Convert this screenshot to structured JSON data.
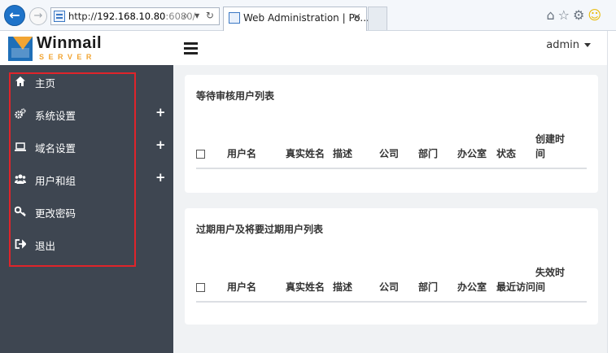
{
  "browser": {
    "url_prefix": "http://",
    "url_host": "192.168.10.80",
    "url_port": ":6080/",
    "address_tools": "⌕ ▾ ↻",
    "tab_title": "Web Administration | Po...",
    "tab_close": "×",
    "back_arrow": "←",
    "forward_arrow": "→",
    "right_icons": [
      "home-icon",
      "star-icon",
      "settings-gear-icon",
      "smiley-icon"
    ]
  },
  "header": {
    "logo_title": "Winmail",
    "logo_sub": "SERVER",
    "user": "admin"
  },
  "sidebar": {
    "items": [
      {
        "label": "主页",
        "icon": "home-icon",
        "expandable": false
      },
      {
        "label": "系统设置",
        "icon": "cogs-icon",
        "expandable": true
      },
      {
        "label": "域名设置",
        "icon": "laptop-icon",
        "expandable": true
      },
      {
        "label": "用户和组",
        "icon": "users-icon",
        "expandable": true
      },
      {
        "label": "更改密码",
        "icon": "key-icon",
        "expandable": false
      },
      {
        "label": "退出",
        "icon": "sign-out-icon",
        "expandable": false
      }
    ],
    "expand_symbol": "+",
    "highlight_color": "#e0242a"
  },
  "panels": {
    "pending": {
      "title": "等待审核用户列表",
      "columns": [
        "用户名",
        "真实姓名",
        "描述",
        "公司",
        "部门",
        "办公室",
        "状态",
        "创建时间"
      ]
    },
    "expired": {
      "title": "过期用户及将要过期用户列表",
      "columns": [
        "用户名",
        "真实姓名",
        "描述",
        "公司",
        "部门",
        "办公室",
        "最近访问",
        "失效时间"
      ]
    }
  },
  "colors": {
    "sidebar_bg": "#3e4651",
    "main_bg": "#f0f2f4",
    "browser_accent": "#1e73c9",
    "logo_orange": "#f2a533"
  }
}
